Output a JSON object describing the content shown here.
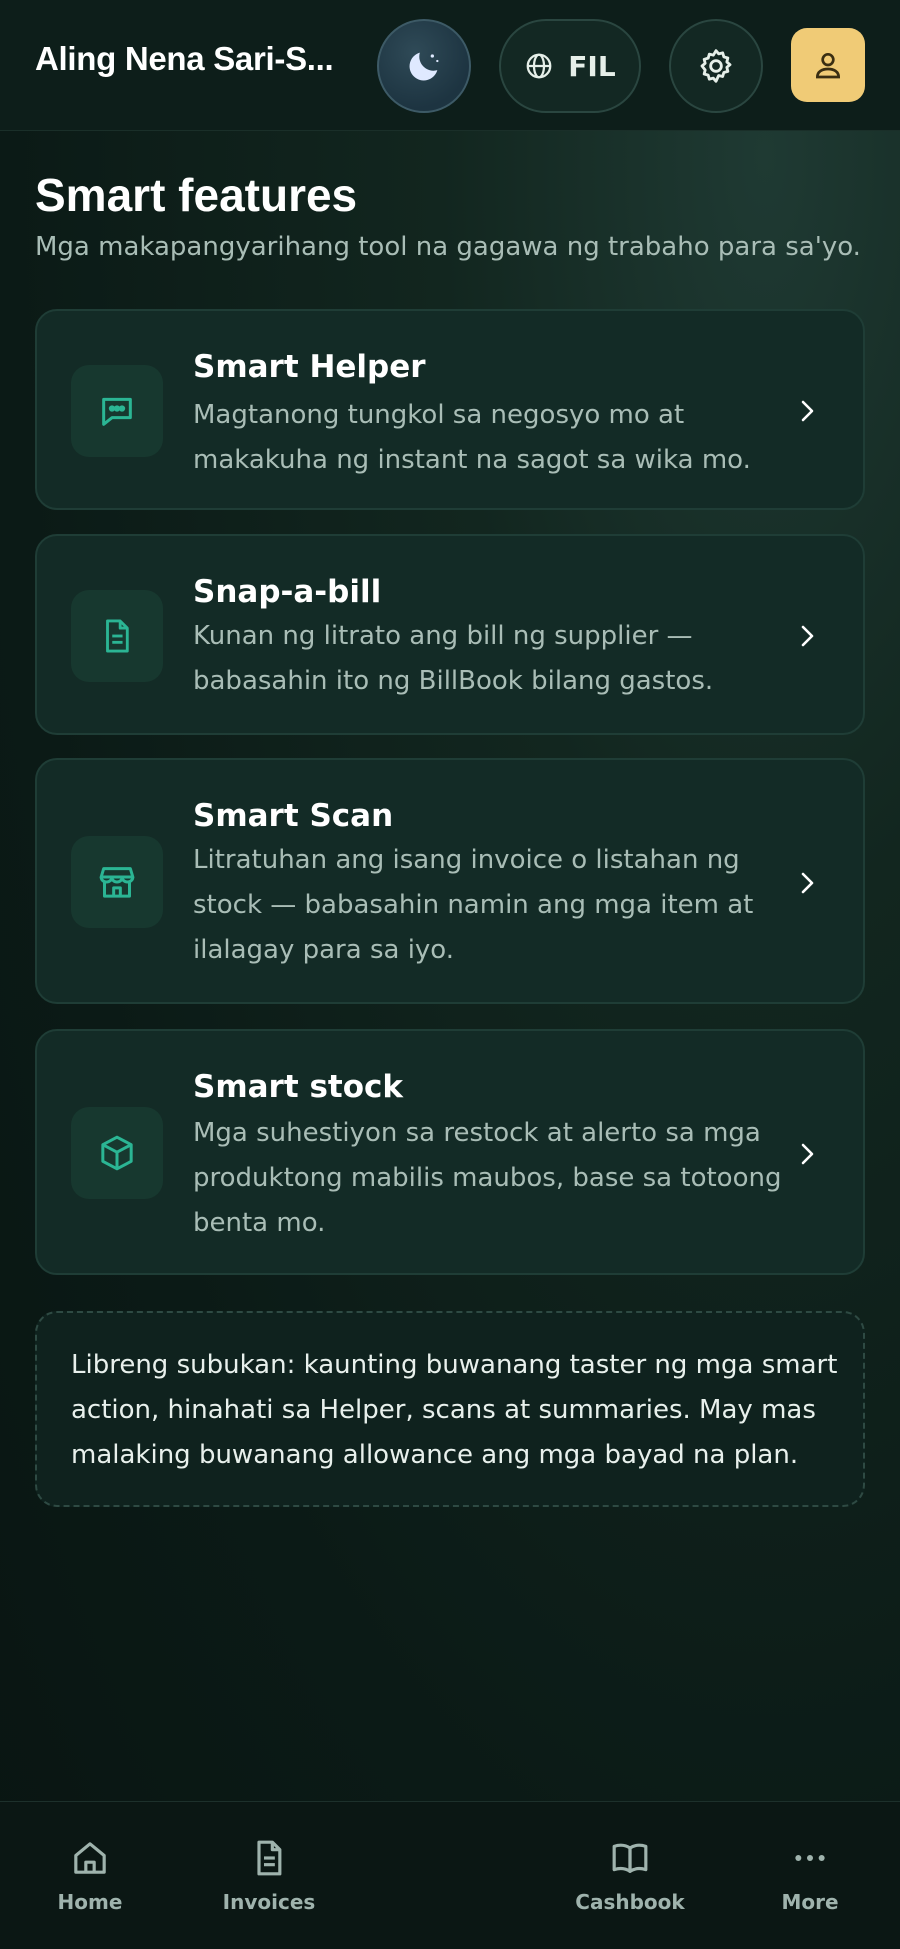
{
  "header": {
    "shop_name": "Aling Nena Sari-S...",
    "language": "FIL"
  },
  "main": {
    "title": "Smart features",
    "subtitle": "Mga makapangyarihang tool na gagawa ng trabaho para sa'yo.",
    "cards": [
      {
        "title": "Smart Helper",
        "description": "Magtanong tungkol sa negosyo mo at makakuha ng instant na sagot sa wika mo.",
        "icon": "chat-bubble-icon"
      },
      {
        "title": "Snap-a-bill",
        "description": "Kunan ng litrato ang bill ng supplier — babasahin ito ng BillBook bilang gastos.",
        "icon": "document-icon"
      },
      {
        "title": "Smart Scan",
        "description": "Litratuhan ang isang invoice o listahan ng stock — babasahin namin ang mga item at ilalagay para sa iyo.",
        "icon": "store-icon"
      },
      {
        "title": "Smart stock",
        "description": "Mga suhestiyon sa restock at alerto sa mga produktong mabilis maubos, base sa totoong benta mo.",
        "icon": "box-icon"
      }
    ],
    "note": "Libreng subukan: kaunting buwanang taster ng mga smart action, hinahati sa Helper, scans at summaries. May mas malaking buwanang allowance ang mga bayad na plan."
  },
  "nav": {
    "home": "Home",
    "invoices": "Invoices",
    "cashbook": "Cashbook",
    "more": "More"
  },
  "colors": {
    "accent": "#2bb594",
    "profile_bg": "#f0cb76",
    "card_bg": "#132b26"
  }
}
